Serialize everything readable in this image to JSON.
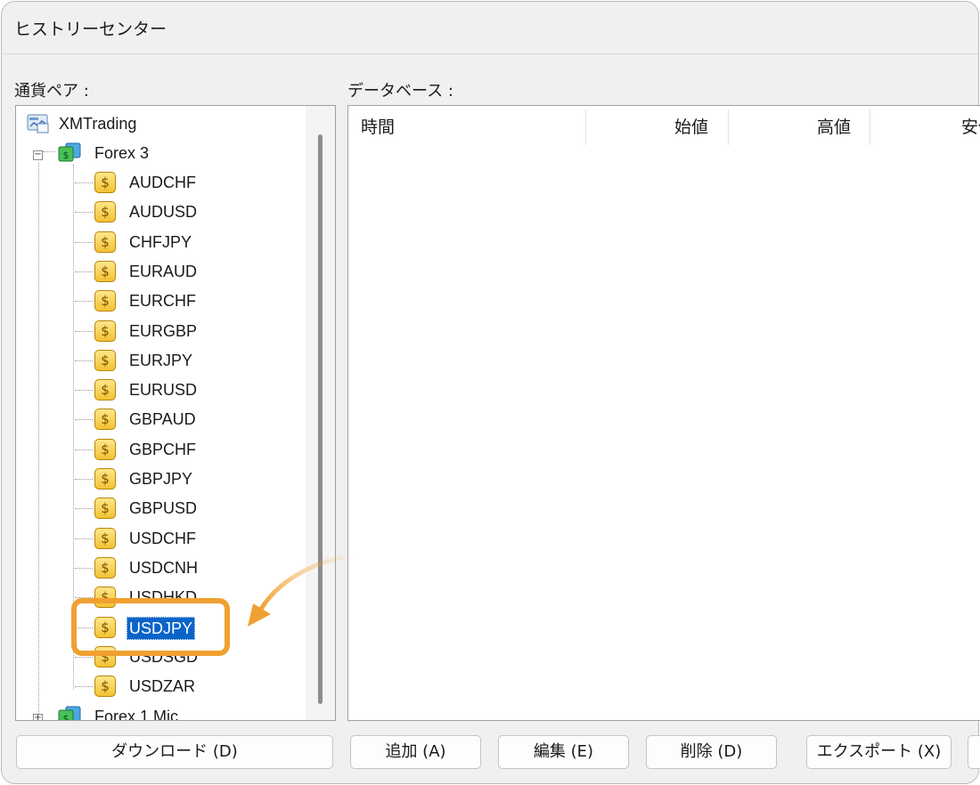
{
  "window": {
    "title": "ヒストリーセンター"
  },
  "left_panel": {
    "label": "通貨ペア :"
  },
  "right_panel": {
    "label": "データベース :"
  },
  "tree": {
    "root": "XMTrading",
    "group": "Forex 3",
    "symbols": [
      "AUDCHF",
      "AUDUSD",
      "CHFJPY",
      "EURAUD",
      "EURCHF",
      "EURGBP",
      "EURJPY",
      "EURUSD",
      "GBPAUD",
      "GBPCHF",
      "GBPJPY",
      "GBPUSD",
      "USDCHF",
      "USDCNH",
      "USDHKD",
      "USDJPY",
      "USDSGD",
      "USDZAR"
    ],
    "selected": "USDJPY",
    "next_group": "Forex 1 Mic"
  },
  "table": {
    "columns": [
      "時間",
      "始値",
      "高値",
      "安値"
    ]
  },
  "buttons": {
    "download": "ダウンロード (D)",
    "add": "追加 (A)",
    "edit": "編集 (E)",
    "delete": "削除 (D)",
    "export": "エクスポート (X)"
  },
  "colors": {
    "highlight": "#f0a030",
    "selection": "#0a64c8",
    "coin": "#f2c233"
  },
  "icons": {
    "root": "server-icon",
    "group": "folder-money-icon",
    "symbol": "dollar-coin-icon"
  }
}
